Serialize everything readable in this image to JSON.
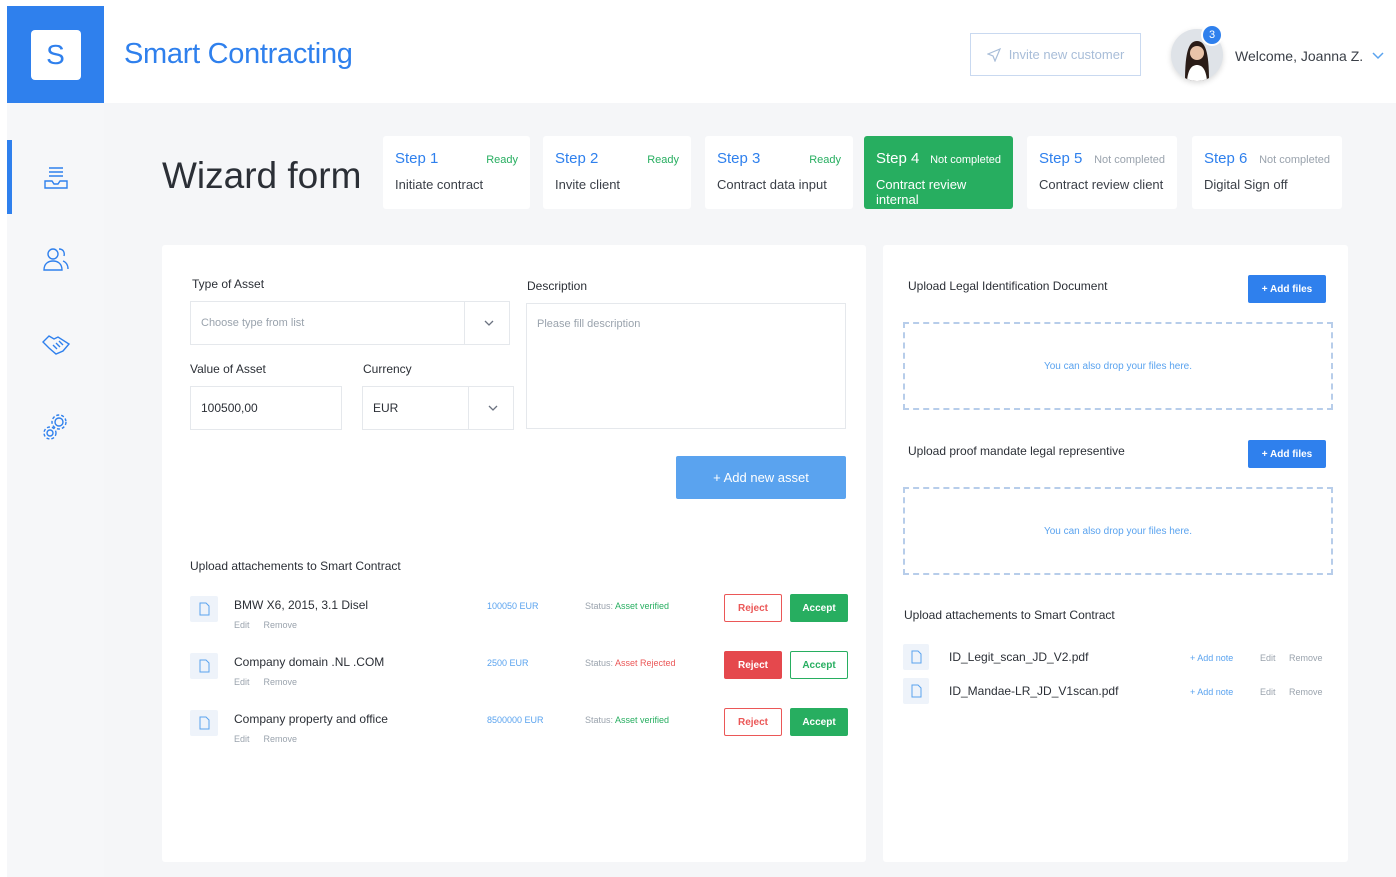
{
  "app": {
    "logo_letter": "S",
    "title": "Smart Contracting"
  },
  "header": {
    "invite_label": "Invite new customer",
    "notification_count": "3",
    "welcome": "Welcome, Joanna Z."
  },
  "page": {
    "title": "Wizard form"
  },
  "steps": [
    {
      "title": "Step 1",
      "status": "Ready",
      "subtitle": "Initiate contract"
    },
    {
      "title": "Step 2",
      "status": "Ready",
      "subtitle": "Invite client"
    },
    {
      "title": "Step 3",
      "status": "Ready",
      "subtitle": "Contract data input"
    },
    {
      "title": "Step 4",
      "status": "Not completed",
      "subtitle": "Contract review internal"
    },
    {
      "title": "Step 5",
      "status": "Not completed",
      "subtitle": "Contract review client"
    },
    {
      "title": "Step 6",
      "status": "Not completed",
      "subtitle": "Digital Sign off"
    }
  ],
  "asset_form": {
    "type_label": "Type of Asset",
    "type_placeholder": "Choose type from list",
    "description_label": "Description",
    "description_placeholder": "Please fill description",
    "value_label": "Value of Asset",
    "value": "100500,00",
    "currency_label": "Currency",
    "currency_value": "EUR",
    "add_asset_label": "+ Add new asset"
  },
  "attachments": {
    "title": "Upload attachements to Smart Contract",
    "status_prefix": "Status:",
    "edit_label": "Edit",
    "remove_label": "Remove",
    "reject_label": "Reject",
    "accept_label": "Accept",
    "items": [
      {
        "name": "BMW X6, 2015, 3.1 Disel",
        "amount": "100050 EUR",
        "status": "Asset verified"
      },
      {
        "name": "Company domain .NL .COM",
        "amount": "2500 EUR",
        "status": "Asset Rejected"
      },
      {
        "name": "Company property and office",
        "amount": "8500000 EUR",
        "status": "Asset verified"
      }
    ]
  },
  "uploads": {
    "legal_id_title": "Upload Legal Identification Document",
    "mandate_title": "Upload proof mandate legal representive",
    "add_files_label": "+ Add files",
    "drop_hint": "You can also drop your files here.",
    "attachments_title": "Upload attachements to Smart Contract",
    "add_note_label": "+ Add note",
    "edit_label": "Edit",
    "remove_label": "Remove",
    "files": [
      {
        "name": "ID_Legit_scan_JD_V2.pdf"
      },
      {
        "name": "ID_Mandae-LR_JD_V1scan.pdf"
      }
    ]
  },
  "colors": {
    "brand": "#2f80ed",
    "success": "#27ae60",
    "danger": "#eb5757"
  }
}
